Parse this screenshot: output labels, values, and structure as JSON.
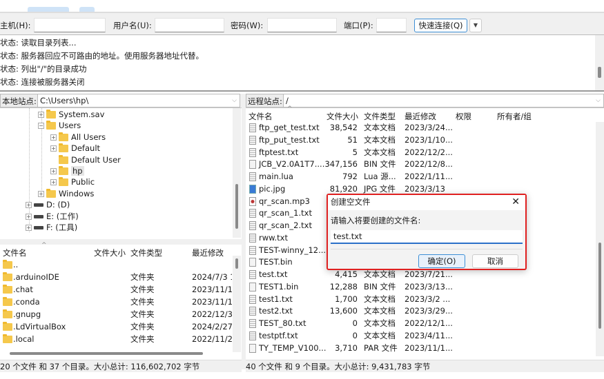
{
  "quickconnect": {
    "host_label": "主机(H):",
    "host_value": "",
    "user_label": "用户名(U):",
    "user_value": "",
    "pass_label": "密码(W):",
    "pass_value": "",
    "port_label": "端口(P):",
    "port_value": "",
    "connect_button": "快速连接(Q)",
    "dropdown_icon": "▼"
  },
  "log": [
    "状态: 读取目录列表...",
    "状态: 服务器回应不可路由的地址。使用服务器地址代替。",
    "状态: 列出\"/\"的目录成功",
    "状态: 连接被服务器关闭"
  ],
  "local": {
    "site_label": "本地站点:",
    "site_path": "C:\\Users\\hp\\",
    "tree": [
      {
        "label": "System.sav",
        "expander": "+",
        "type": "folder"
      },
      {
        "label": "Users",
        "expander": "−",
        "type": "folder"
      },
      {
        "label": "All Users",
        "expander": "+",
        "type": "folder"
      },
      {
        "label": "Default",
        "expander": "+",
        "type": "folder"
      },
      {
        "label": "Default User",
        "expander": "",
        "type": "folder"
      },
      {
        "label": "hp",
        "expander": "+",
        "type": "folder",
        "selected": true
      },
      {
        "label": "Public",
        "expander": "+",
        "type": "folder"
      },
      {
        "label": "Windows",
        "expander": "+",
        "type": "folder"
      },
      {
        "label": "D: (D)",
        "expander": "+",
        "type": "drive"
      },
      {
        "label": "E: (工作)",
        "expander": "+",
        "type": "drive"
      },
      {
        "label": "F: (工具)",
        "expander": "+",
        "type": "drive"
      }
    ],
    "columns": [
      "文件名",
      "文件大小",
      "文件类型",
      "最近修改"
    ],
    "files": [
      {
        "name": "..",
        "size": "",
        "type": "",
        "modified": ""
      },
      {
        "name": ".arduinoIDE",
        "size": "",
        "type": "文件夹",
        "modified": "2024/7/3 1"
      },
      {
        "name": ".chat",
        "size": "",
        "type": "文件夹",
        "modified": "2023/11/1"
      },
      {
        "name": ".conda",
        "size": "",
        "type": "文件夹",
        "modified": "2023/11/1"
      },
      {
        "name": ".gnupg",
        "size": "",
        "type": "文件夹",
        "modified": "2022/12/3"
      },
      {
        "name": ".LdVirtualBox",
        "size": "",
        "type": "文件夹",
        "modified": "2024/2/27"
      },
      {
        "name": ".local",
        "size": "",
        "type": "文件夹",
        "modified": "2022/11/2"
      }
    ],
    "status": "20 个文件 和 37 个目录。大小总计: 116,602,702 字节"
  },
  "remote": {
    "site_label": "远程站点:",
    "site_path": "/",
    "columns": [
      "文件名",
      "文件大小",
      "文件类型",
      "最近修改",
      "权限",
      "所有者/组"
    ],
    "files": [
      {
        "name": "ftp_get_test.txt",
        "size": "38,542",
        "type": "文本文档",
        "modified": "2023/3/24...",
        "icon": "text-file"
      },
      {
        "name": "ftp_put_test.txt",
        "size": "51",
        "type": "文本文档",
        "modified": "2023/1/10...",
        "icon": "text-file"
      },
      {
        "name": "ftptest.txt",
        "size": "5",
        "type": "文本文档",
        "modified": "2022/12/2...",
        "icon": "text-file"
      },
      {
        "name": "JCB_V2.0A1T7....",
        "size": "347,156",
        "type": "BIN 文件",
        "modified": "2022/12/8...",
        "icon": "blank-file"
      },
      {
        "name": "main.lua",
        "size": "792",
        "type": "Lua 源...",
        "modified": "2022/1/11...",
        "icon": "text-file"
      },
      {
        "name": "pic.jpg",
        "size": "81,920",
        "type": "JPG 文件",
        "modified": "2023/3/13",
        "icon": "image-file"
      },
      {
        "name": "qr_scan.mp3",
        "size": "",
        "type": "",
        "modified": "",
        "icon": "audio-file"
      },
      {
        "name": "qr_scan_1.txt",
        "size": "",
        "type": "",
        "modified": "",
        "icon": "text-file"
      },
      {
        "name": "qr_scan_2.txt",
        "size": "",
        "type": "",
        "modified": "",
        "icon": "text-file"
      },
      {
        "name": "rww.txt",
        "size": "",
        "type": "",
        "modified": "",
        "icon": "text-file"
      },
      {
        "name": "TEST-winny_12...",
        "size": "",
        "type": "",
        "modified": "",
        "icon": "text-file"
      },
      {
        "name": "TEST.bin",
        "size": "",
        "type": "",
        "modified": "",
        "icon": "blank-file"
      },
      {
        "name": "test.txt",
        "size": "4,415",
        "type": "文本文档",
        "modified": "2023/7/21...",
        "icon": "text-file"
      },
      {
        "name": "TEST1.bin",
        "size": "12,288",
        "type": "BIN 文件",
        "modified": "2023/3/13...",
        "icon": "blank-file"
      },
      {
        "name": "test1.txt",
        "size": "1,700",
        "type": "文本文档",
        "modified": "2023/3/2 ...",
        "icon": "text-file"
      },
      {
        "name": "test2.txt",
        "size": "13,600",
        "type": "文本文档",
        "modified": "2023/3/29...",
        "icon": "text-file"
      },
      {
        "name": "TEST_80.txt",
        "size": "0",
        "type": "文本文档",
        "modified": "2022/12/1...",
        "icon": "text-file"
      },
      {
        "name": "testptf.txt",
        "size": "0",
        "type": "文本文档",
        "modified": "2023/4/11...",
        "icon": "text-file"
      },
      {
        "name": "TY_TEMP_V100...",
        "size": "3,710",
        "type": "PAR 文件",
        "modified": "2023/11/1...",
        "icon": "blank-file"
      }
    ],
    "status": "40 个文件 和 9 个目录。大小总计: 9,431,783 字节"
  },
  "dialog": {
    "title": "创建空文件",
    "close_icon": "✕",
    "prompt": "请输入将要创建的文件名:",
    "value": "test.txt",
    "ok_button": "确定(O)",
    "cancel_button": "取消",
    "highlight_color": "#e02020"
  }
}
